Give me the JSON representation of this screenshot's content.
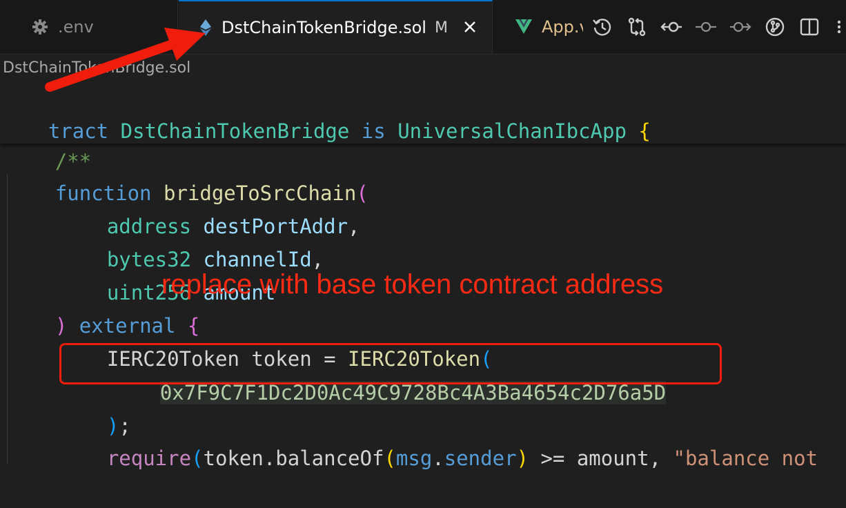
{
  "tabs": [
    {
      "label": ".env",
      "icon": "gear-icon"
    },
    {
      "label": "DstChainTokenBridge.sol",
      "icon": "solidity-diamond-icon",
      "modified": "M",
      "active": true
    },
    {
      "label": "App.v",
      "icon": "vue-icon"
    }
  ],
  "editor_actions": [
    "history-icon",
    "compare-changes-icon",
    "go-back-icon",
    "commit-icon",
    "go-forward-icon",
    "source-control-graph-icon",
    "split-editor-icon"
  ],
  "breadcrumb": "DstChainTokenBridge.sol",
  "code": {
    "l1": {
      "t1": "tract ",
      "t2": "DstChainTokenBridge",
      "t3": " is ",
      "t4": "UniversalChanIbcApp",
      "t5": " {"
    },
    "l2": {
      "t1": "/**"
    },
    "l3": {
      "t1": "function ",
      "t2": "bridgeToSrcChain",
      "t3": "("
    },
    "l4": {
      "t1": "address ",
      "t2": "destPortAddr",
      "t3": ","
    },
    "l5": {
      "t1": "bytes32 ",
      "t2": "channelId",
      "t3": ","
    },
    "l6": {
      "t1": "uint256 ",
      "t2": "amount"
    },
    "l7": {
      "t1": ") ",
      "t2": "external ",
      "t3": "{"
    },
    "l8": {
      "t1": "IERC20Token token = ",
      "t2": "IERC20Token",
      "t3": "("
    },
    "l9": {
      "t1": "0x7F9C7F1Dc2D0Ac49C9728Bc4A3Ba4654c2D76a5D"
    },
    "l10": {
      "t1": ")",
      "t2": ";"
    },
    "l11": {
      "t1": "require",
      "t2": "(",
      "t3": "token.balanceOf",
      "t4": "(",
      "t5": "msg",
      "t6": ".",
      "t7": "sender",
      "t8": ")",
      "t9": " >= amount, ",
      "t10": "\"balance not"
    }
  },
  "annotation": "replace with base token contract address",
  "colors": {
    "annotation": "#ff2a14",
    "active_tab_border": "#0078d4"
  }
}
